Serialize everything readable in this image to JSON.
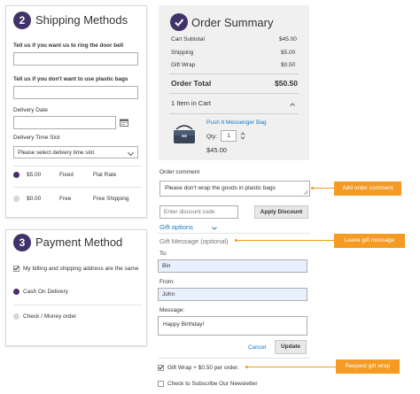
{
  "shipping": {
    "step": "2",
    "title": "Shipping Methods",
    "doorbell_label": "Tell us if you want us to ring the door bell",
    "plastic_label": "Tell us if you don't want to use plastic bags",
    "delivery_date_label": "Delivery Date",
    "time_slot_label": "Delivery Time Slot",
    "time_slot_value": "Please select delivery time slot",
    "methods": [
      {
        "price": "$5.00",
        "carrier": "Fixed",
        "name": "Flat Rate",
        "selected": true
      },
      {
        "price": "$0.00",
        "carrier": "Free",
        "name": "Free Shipping",
        "selected": false
      }
    ]
  },
  "payment": {
    "step": "3",
    "title": "Payment Method",
    "billing_same": "My billing and shipping address are the same",
    "cod": "Cash On Delivery",
    "check": "Check / Money order"
  },
  "summary": {
    "title": "Order Summary",
    "rows": [
      {
        "label": "Cart Subtotal",
        "value": "$45.00"
      },
      {
        "label": "Shipping",
        "value": "$5.00"
      },
      {
        "label": "Gift Wrap",
        "value": "$0.50"
      }
    ],
    "total_label": "Order Total",
    "total_value": "$50.50",
    "items_in_cart": "1 Item in Cart",
    "product_name": "Push It Messenger Bag",
    "qty_label": "Qty:",
    "qty_value": "1",
    "product_price": "$45.00"
  },
  "comment": {
    "label": "Order comment",
    "value": "Please don't wrap the goods in plastic bags"
  },
  "discount": {
    "placeholder": "Enter discount code",
    "button": "Apply Discount"
  },
  "gift": {
    "options_label": "Gift options",
    "message_label": "Gift Message (optional)",
    "to_label": "To:",
    "to_value": "Bin",
    "from_label": "From:",
    "from_value": "John",
    "message_field_label": "Message:",
    "message_value": "Happy Birthday!",
    "cancel": "Cancel",
    "update": "Update",
    "wrap_label": "Gift Wrap + $0.50 per order.",
    "newsletter_label": "Check to Subscribe Our Newsletter"
  },
  "callouts": {
    "add_comment": "Add order comment",
    "leave_gift": "Leave gift message",
    "request_wrap": "Request gift wrap"
  },
  "colors": {
    "brand_purple": "#3f3369",
    "callout_orange": "#f59a23",
    "link_blue": "#1979c3"
  }
}
